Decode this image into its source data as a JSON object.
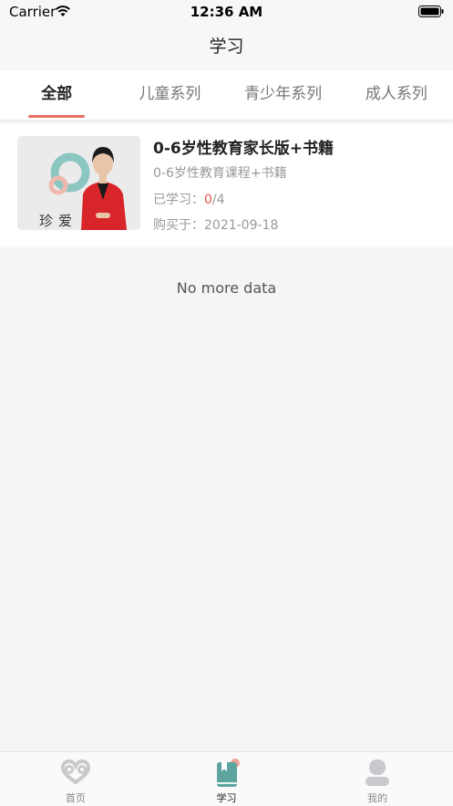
{
  "status_bar": {
    "carrier": "Carrier",
    "time": "12:36 AM"
  },
  "nav": {
    "title": "学习"
  },
  "tabs": [
    {
      "label": "全部",
      "active": true
    },
    {
      "label": "儿童系列",
      "active": false
    },
    {
      "label": "青少年系列",
      "active": false
    },
    {
      "label": "成人系列",
      "active": false
    }
  ],
  "course": {
    "title": "0-6岁性教育家长版+书籍",
    "subtitle": "0-6岁性教育课程+书籍",
    "progress_label": "已学习：",
    "progress_done": "0",
    "progress_total": "/4",
    "purchase_label": "购买于：",
    "purchase_date": "2021-09-18",
    "thumbnail_text": "珍爱"
  },
  "list_footer": "No more data",
  "tab_bar": [
    {
      "label": "首页",
      "icon": "heart-loop-icon"
    },
    {
      "label": "学习",
      "icon": "book-icon"
    },
    {
      "label": "我的",
      "icon": "user-icon"
    }
  ],
  "colors": {
    "accent": "#e8705f",
    "progress_red": "#e8504a",
    "book_teal": "#5ea5a0"
  }
}
